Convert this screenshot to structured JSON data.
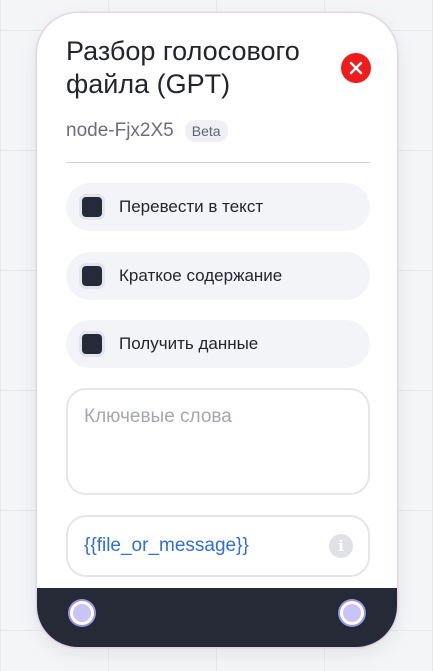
{
  "node": {
    "title": "Разбор голосового файла (GPT)",
    "id": "node-Fjx2X5",
    "badge": "Beta",
    "options": [
      {
        "label": "Перевести в текст",
        "checked": true
      },
      {
        "label": "Краткое содержание",
        "checked": true
      },
      {
        "label": "Получить данные",
        "checked": true
      }
    ],
    "keywords_placeholder": "Ключевые слова",
    "variable_value": "{{file_or_message}}",
    "icons": {
      "close": "close-icon",
      "info": "info-icon"
    },
    "colors": {
      "close": "#ee1c1c",
      "footer": "#262a37",
      "port": "#c9c4f7",
      "variable": "#2f6fd6"
    }
  }
}
